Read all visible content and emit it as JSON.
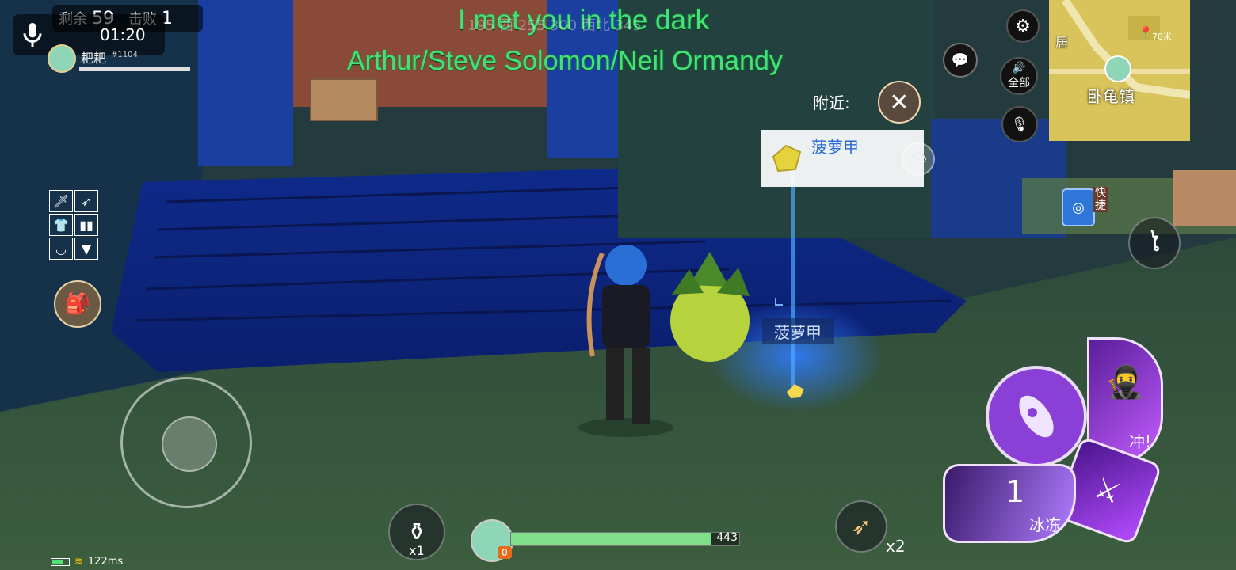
{
  "lyrics": {
    "line1": "I met you in the dark",
    "line2": "Arthur/Steve Solomon/Neil Ormandy"
  },
  "top_left": {
    "remaining_label": "剩余",
    "remaining_count": "59",
    "kills_label": "击败",
    "kills_count": "1",
    "timer": "01:20",
    "player_name": "耙耙",
    "player_id": "#1104"
  },
  "compass": {
    "readout": "195 西 255 300 西北 345"
  },
  "map": {
    "label_residence": "居",
    "distance": "70米",
    "town_name": "卧龟镇"
  },
  "right_buttons": {
    "voice_all": "全部"
  },
  "nearby": {
    "label": "附近:",
    "item_name": "菠萝甲"
  },
  "world": {
    "item_label": "菠萝甲"
  },
  "quick": {
    "label": "快捷"
  },
  "bottom": {
    "potion_count": "x1",
    "hp_value": "443",
    "level_badge": "0",
    "arrows_count": "x2",
    "skill1_charges": "1",
    "skill1_name": "冰冻",
    "skill_dash_name": "冲!"
  },
  "status": {
    "ping": "122ms"
  },
  "colors": {
    "lyric": "#46e07a",
    "skill_purple": "#8a3fd6",
    "hp_green": "#7ee08a",
    "map_yellow": "#d8c45a"
  }
}
